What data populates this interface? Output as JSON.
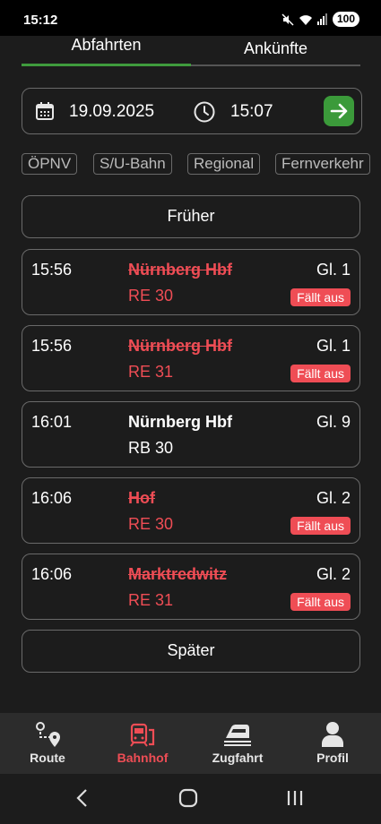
{
  "status_bar": {
    "time": "15:12",
    "battery": "100"
  },
  "tabs": {
    "departures": "Abfahrten",
    "arrivals": "Ankünfte",
    "active": "departures"
  },
  "datetime": {
    "date": "19.09.2025",
    "time": "15:07"
  },
  "filters": [
    "ÖPNV",
    "S/U-Bahn",
    "Regional",
    "Fernverkehr"
  ],
  "earlier_label": "Früher",
  "later_label": "Später",
  "departures": [
    {
      "time": "15:56",
      "destination": "Nürnberg Hbf",
      "track": "Gl. 1",
      "line": "RE 30",
      "cancelled": true,
      "status": "Fällt aus"
    },
    {
      "time": "15:56",
      "destination": "Nürnberg Hbf",
      "track": "Gl. 1",
      "line": "RE 31",
      "cancelled": true,
      "status": "Fällt aus"
    },
    {
      "time": "16:01",
      "destination": "Nürnberg Hbf",
      "track": "Gl. 9",
      "line": "RB 30",
      "cancelled": false,
      "status": ""
    },
    {
      "time": "16:06",
      "destination": "Hof",
      "track": "Gl. 2",
      "line": "RE 30",
      "cancelled": true,
      "status": "Fällt aus"
    },
    {
      "time": "16:06",
      "destination": "Marktredwitz",
      "track": "Gl. 2",
      "line": "RE 31",
      "cancelled": true,
      "status": "Fällt aus"
    }
  ],
  "bottom_nav": [
    {
      "label": "Route",
      "icon": "route-icon",
      "active": false
    },
    {
      "label": "Bahnhof",
      "icon": "station-icon",
      "active": true
    },
    {
      "label": "Zugfahrt",
      "icon": "train-icon",
      "active": false
    },
    {
      "label": "Profil",
      "icon": "person-icon",
      "active": false
    }
  ],
  "colors": {
    "accent_green": "#3f9b3d",
    "cancel_red": "#ef4d55",
    "background": "#1c1c1c"
  }
}
